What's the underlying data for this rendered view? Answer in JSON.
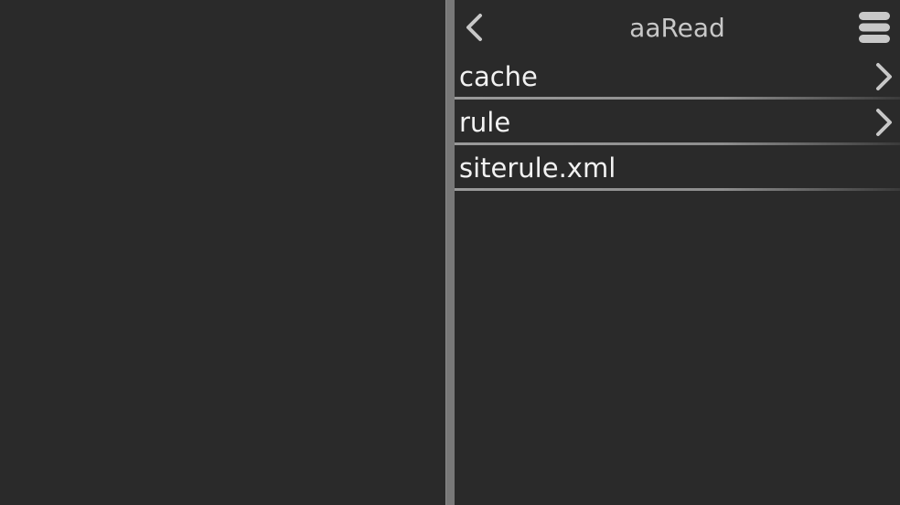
{
  "app": {
    "title": "aaRead"
  },
  "toolbar": {
    "back_icon": "chevron-left-icon",
    "menu_icon": "menu-icon"
  },
  "files": [
    {
      "label": "cache",
      "type": "folder"
    },
    {
      "label": "rule",
      "type": "folder"
    },
    {
      "label": "siterule.xml",
      "type": "file"
    }
  ],
  "colors": {
    "background": "#2a2a2a",
    "divider": "#787878",
    "title_text": "#c8c8c8",
    "item_text": "#f2f2f2",
    "icon": "#c8c8c8"
  }
}
